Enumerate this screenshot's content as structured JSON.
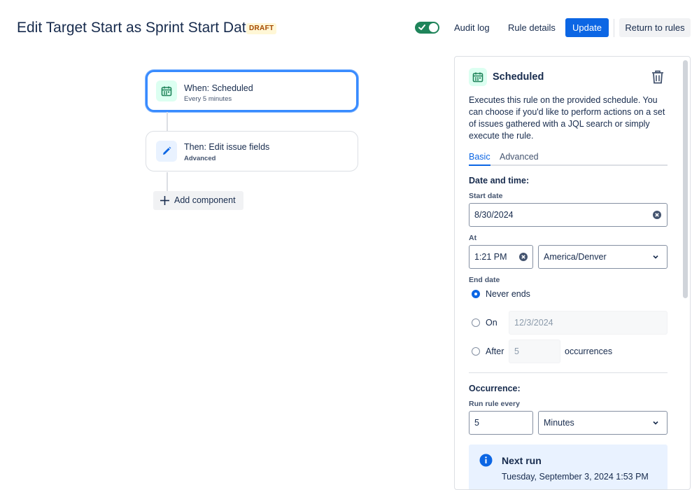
{
  "header": {
    "title": "Edit Target Start as Sprint Start Date",
    "status_badge": "DRAFT",
    "enabled": true,
    "audit_log_label": "Audit log",
    "rule_details_label": "Rule details",
    "update_label": "Update",
    "return_label": "Return to rules"
  },
  "canvas": {
    "trigger": {
      "title": "When: Scheduled",
      "subtitle": "Every 5 minutes",
      "icon": "calendar-icon"
    },
    "action": {
      "title": "Then: Edit issue fields",
      "subtitle": "Advanced",
      "icon": "pencil-icon"
    },
    "add_component_label": "Add component"
  },
  "panel": {
    "title": "Scheduled",
    "description": "Executes this rule on the provided schedule. You can choose if you'd like to perform actions on a set of issues gathered with a JQL search or simply execute the rule.",
    "tabs": [
      "Basic",
      "Advanced"
    ],
    "active_tab": "Basic",
    "date_time_heading": "Date and time:",
    "start_date_label": "Start date",
    "start_date_value": "8/30/2024",
    "at_label": "At",
    "time_value": "1:21 PM",
    "timezone_value": "America/Denver",
    "end_date_label": "End date",
    "end_options": {
      "never": "Never ends",
      "on": "On",
      "on_date_placeholder": "12/3/2024",
      "after": "After",
      "after_count_placeholder": "5",
      "after_suffix": "occurrences"
    },
    "end_selected": "never",
    "occurrence_heading": "Occurrence:",
    "run_every_label": "Run rule every",
    "run_every_value": "5",
    "run_every_unit": "Minutes",
    "next_run_title": "Next run",
    "next_run_text": "Tuesday, September 3, 2024 1:53 PM"
  },
  "colors": {
    "primary": "#0c66e4",
    "toggle_on": "#1f845a",
    "draft_text": "#a54800",
    "draft_bg": "#fff7d6",
    "info_bg": "#e9f2ff"
  }
}
